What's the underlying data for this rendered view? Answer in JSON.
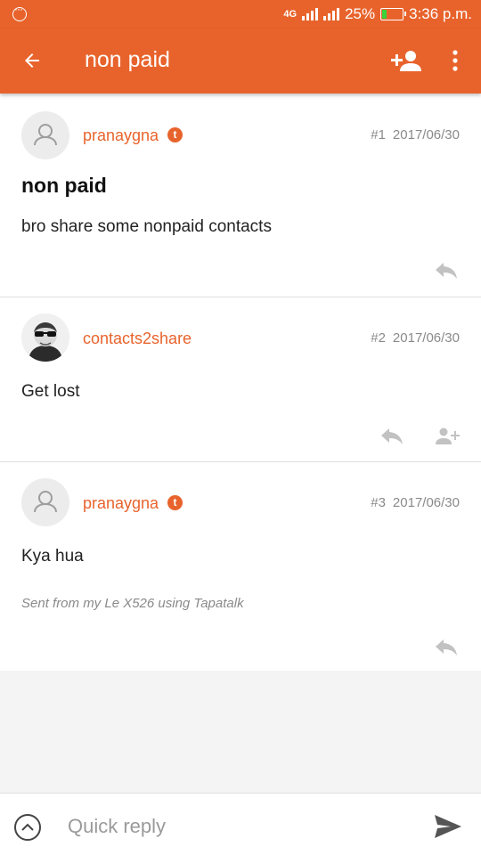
{
  "status_bar": {
    "network": "4G",
    "battery_pct": "25%",
    "battery_level": 0.25,
    "time": "3:36 p.m."
  },
  "app_bar": {
    "title": "non paid",
    "icons": [
      "back-arrow-icon",
      "add-user-icon",
      "more-vert-icon"
    ]
  },
  "posts": [
    {
      "author": "pranaygna",
      "number": "#1",
      "date": "2017/06/30",
      "title": "non paid",
      "body": "bro share some nonpaid contacts",
      "badge": "t"
    },
    {
      "author": "contacts2share",
      "number": "#2",
      "date": "2017/06/30",
      "body": "Get lost"
    },
    {
      "author": "pranaygna",
      "number": "#3",
      "date": "2017/06/30",
      "body": "Kya hua",
      "signature": "Sent from my Le X526 using Tapatalk",
      "badge": "t"
    }
  ],
  "quick_reply": {
    "placeholder": "Quick reply"
  },
  "colors": {
    "brand": "#e8632c",
    "battery": "#3ad13a",
    "meta_text": "#8a8a8a",
    "icon_gray": "#c2c2c2"
  }
}
